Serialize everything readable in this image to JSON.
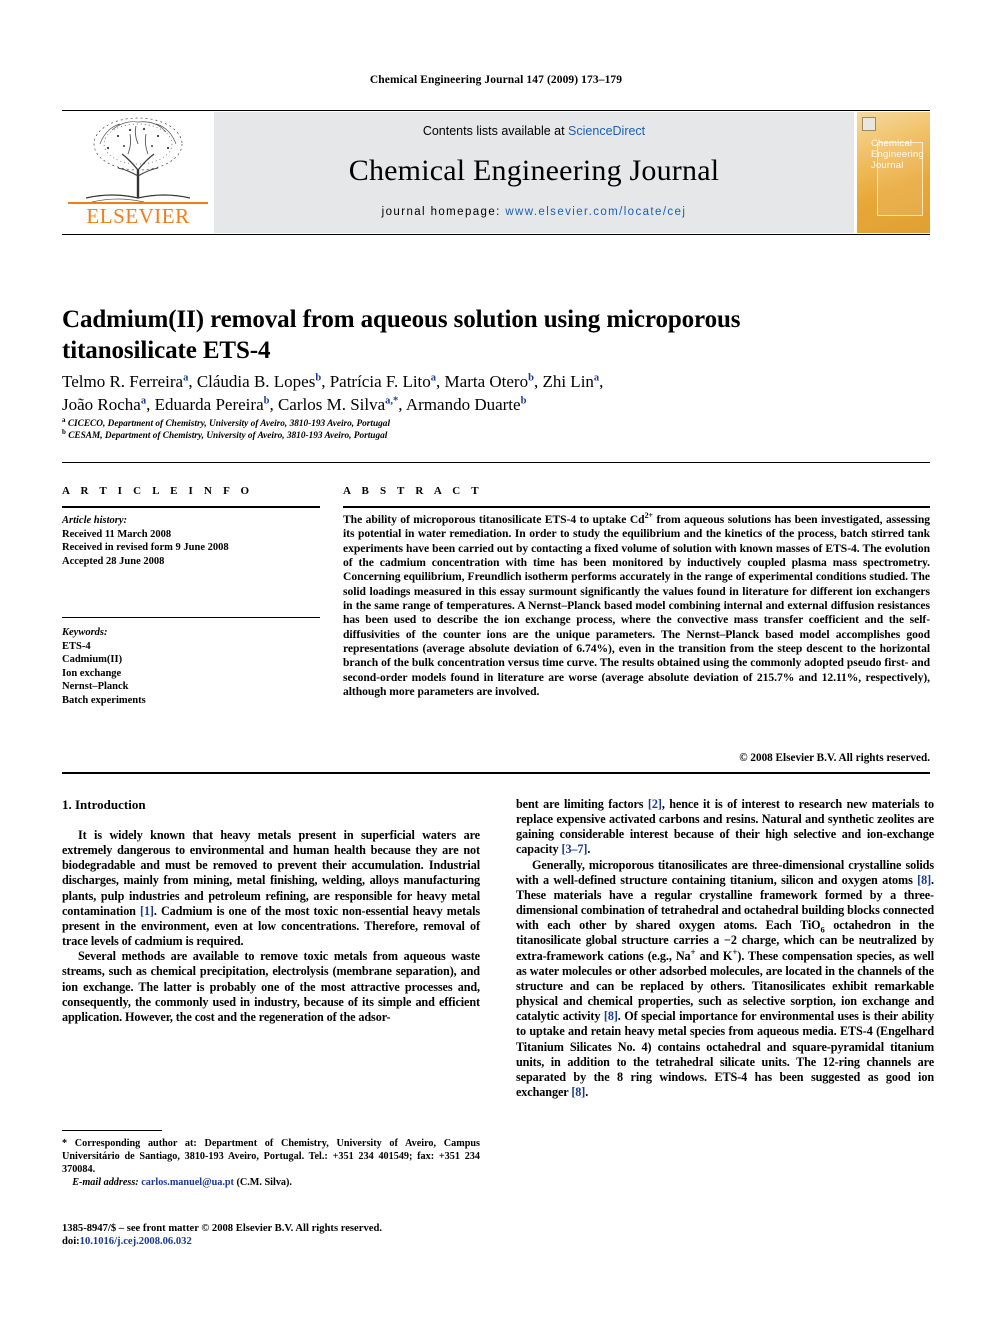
{
  "running_head": "Chemical Engineering Journal 147 (2009) 173–179",
  "masthead": {
    "publisher": "ELSEVIER",
    "contents_prefix": "Contents lists available at ",
    "contents_link": "ScienceDirect",
    "journal_name": "Chemical Engineering Journal",
    "homepage_prefix": "journal homepage: ",
    "homepage_url": "www.elsevier.com/locate/cej",
    "cover_title": "Chemical Engineering Journal"
  },
  "article": {
    "title": "Cadmium(II) removal from aqueous solution using microporous titanosilicate ETS-4",
    "authors_line1": "Telmo R. Ferreira a, Cláudia B. Lopes b, Patrícia F. Lito a, Marta Otero b, Zhi Lin a,",
    "authors_line2": "João Rocha a, Eduarda Pereira b, Carlos M. Silva a,*, Armando Duarte b",
    "affiliation_a": "CICECO, Department of Chemistry, University of Aveiro, 3810-193 Aveiro, Portugal",
    "affiliation_b": "CESAM, Department of Chemistry, University of Aveiro, 3810-193 Aveiro, Portugal"
  },
  "info": {
    "label": "A R T I C L E   I N F O",
    "history_header": "Article history:",
    "history": [
      "Received 11 March 2008",
      "Received in revised form 9 June 2008",
      "Accepted 28 June 2008"
    ],
    "keywords_header": "Keywords:",
    "keywords": [
      "ETS-4",
      "Cadmium(II)",
      "Ion exchange",
      "Nernst–Planck",
      "Batch experiments"
    ]
  },
  "abstract": {
    "label": "A B S T R A C T",
    "text_part1": "The ability of microporous titanosilicate ETS-4 to uptake Cd",
    "text_sup": "2+",
    "text_part2": " from aqueous solutions has been investigated, assessing its potential in water remediation. In order to study the equilibrium and the kinetics of the process, batch stirred tank experiments have been carried out by contacting a fixed volume of solution with known masses of ETS-4. The evolution of the cadmium concentration with time has been monitored by inductively coupled plasma mass spectrometry. Concerning equilibrium, Freundlich isotherm performs accurately in the range of experimental conditions studied. The solid loadings measured in this essay surmount significantly the values found in literature for different ion exchangers in the same range of temperatures. A Nernst–Planck based model combining internal and external diffusion resistances has been used to describe the ion exchange process, where the convective mass transfer coefficient and the self-diffusivities of the counter ions are the unique parameters. The Nernst–Planck based model accomplishes good representations (average absolute deviation of 6.74%), even in the transition from the steep descent to the horizontal branch of the bulk concentration versus time curve. The results obtained using the commonly adopted pseudo first- and second-order models found in literature are worse (average absolute deviation of 215.7% and 12.11%, respectively), although more parameters are involved.",
    "copyright": "© 2008 Elsevier B.V. All rights reserved."
  },
  "body": {
    "section_heading": "1.  Introduction",
    "left_p1_a": "It is widely known that heavy metals present in superficial waters are extremely dangerous to environmental and human health because they are not biodegradable and must be removed to prevent their accumulation. Industrial discharges, mainly from mining, metal finishing, welding, alloys manufacturing plants, pulp industries and petroleum refining, are responsible for heavy metal contamination ",
    "left_p1_ref": "[1]",
    "left_p1_b": ". Cadmium is one of the most toxic non-essential heavy metals present in the environment, even at low concentrations. Therefore, removal of trace levels of cadmium is required.",
    "left_p2": "Several methods are available to remove toxic metals from aqueous waste streams, such as chemical precipitation, electrolysis (membrane separation), and ion exchange. The latter is probably one of the most attractive processes and, consequently, the commonly used in industry, because of its simple and efficient application. However, the cost and the regeneration of the adsor-",
    "right_p1_a": "bent are limiting factors ",
    "right_p1_ref": "[2]",
    "right_p1_b": ", hence it is of interest to research new materials to replace expensive activated carbons and resins. Natural and synthetic zeolites are gaining considerable interest because of their high selective and ion-exchange capacity ",
    "right_p1_ref2": "[3–7]",
    "right_p1_c": ".",
    "right_p2_a": "Generally, microporous titanosilicates are three-dimensional crystalline solids with a well-defined structure containing titanium, silicon and oxygen atoms ",
    "right_p2_ref1": "[8]",
    "right_p2_b": ". These materials have a regular crystalline framework formed by a three-dimensional combination of tetrahedral and octahedral building blocks connected with each other by shared oxygen atoms. Each TiO",
    "right_p2_sub": "6",
    "right_p2_c": " octahedron in the titanosilicate global structure carries a −2 charge, which can be neutralized by extra-framework cations (e.g., Na",
    "right_p2_sup1": "+",
    "right_p2_d": " and K",
    "right_p2_sup2": "+",
    "right_p2_e": "). These compensation species, as well as water molecules or other adsorbed molecules, are located in the channels of the structure and can be replaced by others. Titanosilicates exhibit remarkable physical and chemical properties, such as selective sorption, ion exchange and catalytic activity ",
    "right_p2_ref2": "[8]",
    "right_p2_f": ". Of special importance for environmental uses is their ability to uptake and retain heavy metal species from aqueous media. ETS-4 (Engelhard Titanium Silicates No. 4) contains octahedral and square-pyramidal titanium units, in addition to the tetrahedral silicate units. The 12-ring channels are separated by the 8 ring windows. ETS-4 has been suggested as good ion exchanger ",
    "right_p2_ref3": "[8]",
    "right_p2_g": "."
  },
  "footnotes": {
    "corresponding": "*  Corresponding author at: Department of Chemistry, University of Aveiro, Campus Universitário de Santiago, 3810-193 Aveiro, Portugal. Tel.: +351 234 401549; fax: +351 234 370084.",
    "email_label": "E-mail address:",
    "email_address": "carlos.manuel@ua.pt",
    "email_suffix": " (C.M. Silva).",
    "issn_line": "1385-8947/$ – see front matter © 2008 Elsevier B.V. All rights reserved.",
    "doi_label": "doi:",
    "doi_value": "10.1016/j.cej.2008.06.032"
  },
  "colors": {
    "link": "#1a5fb4",
    "reference": "#1a3a8f",
    "elsevier_orange": "#ef7d1a",
    "masthead_bg": "#e6e7e9"
  }
}
